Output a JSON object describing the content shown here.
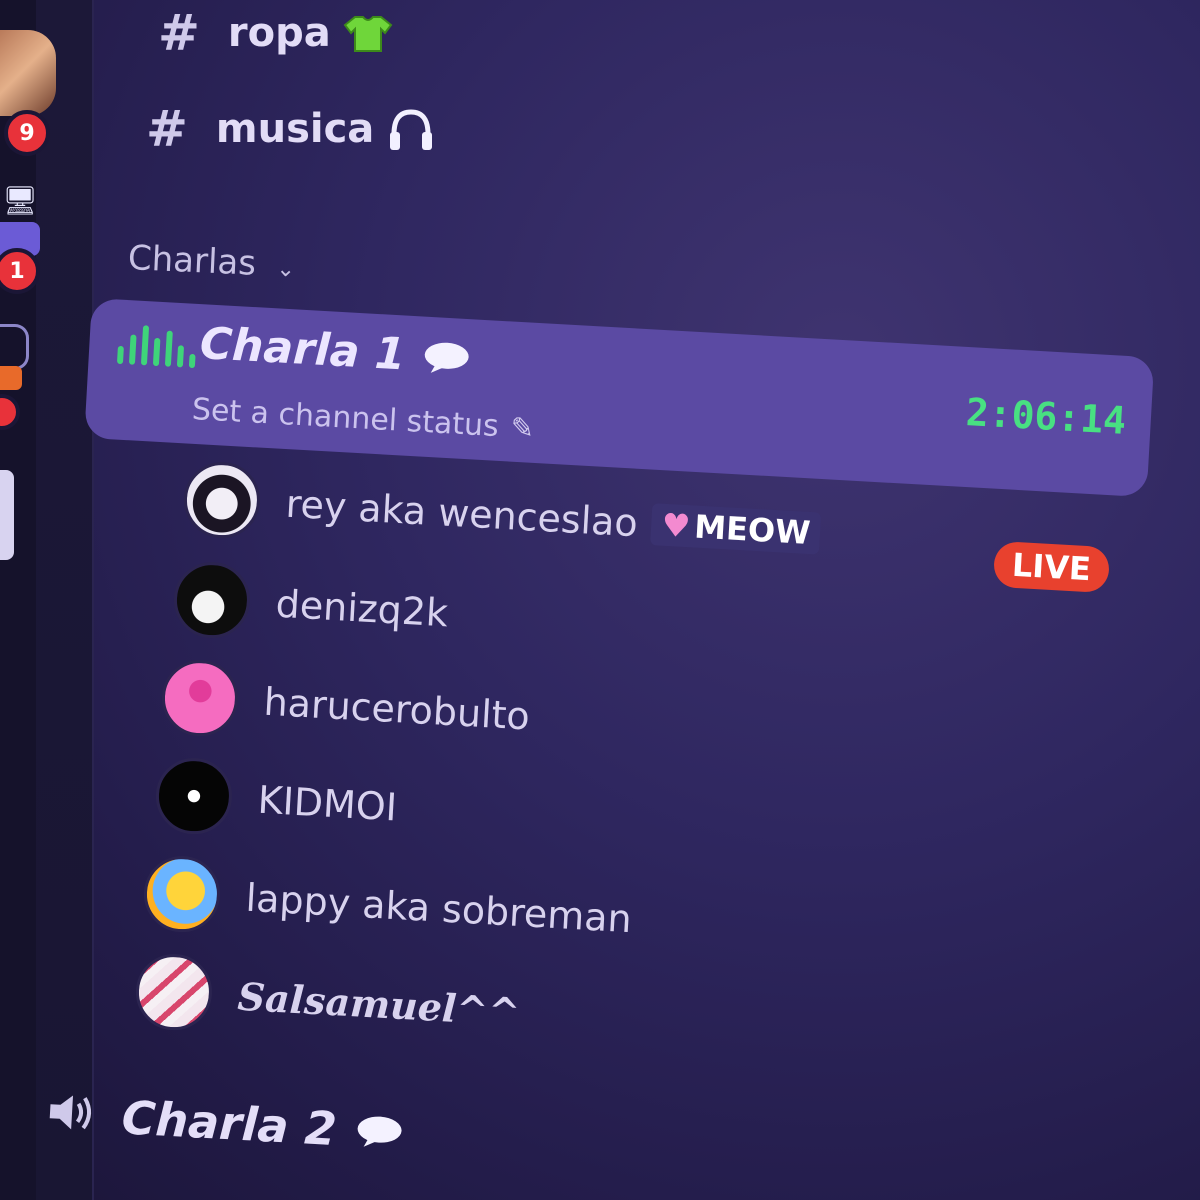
{
  "channels": [
    {
      "name": "ropa",
      "icon": "tshirt-icon"
    },
    {
      "name": "musica",
      "icon": "headphones-icon"
    }
  ],
  "category": {
    "label": "Charlas"
  },
  "voice_channels": [
    {
      "name": "Charla 1",
      "status_prompt": "Set a channel status",
      "timer": "2:06:14",
      "users": [
        {
          "name": "rey aka wenceslao",
          "tag": "MEOW",
          "tag_icon": "heart-icon",
          "live": "LIVE"
        },
        {
          "name": "denizq2k"
        },
        {
          "name": "harucerobulto"
        },
        {
          "name": "KIDMOI"
        },
        {
          "name": "lappy aka sobreman"
        },
        {
          "name": "Salsamuel^^"
        }
      ]
    },
    {
      "name": "Charla 2"
    }
  ],
  "rail": {
    "badges": [
      "9",
      "1"
    ]
  },
  "colors": {
    "accent_active": "#5b4aa3",
    "voice_green": "#3fd47a",
    "live_red": "#e8412e"
  }
}
